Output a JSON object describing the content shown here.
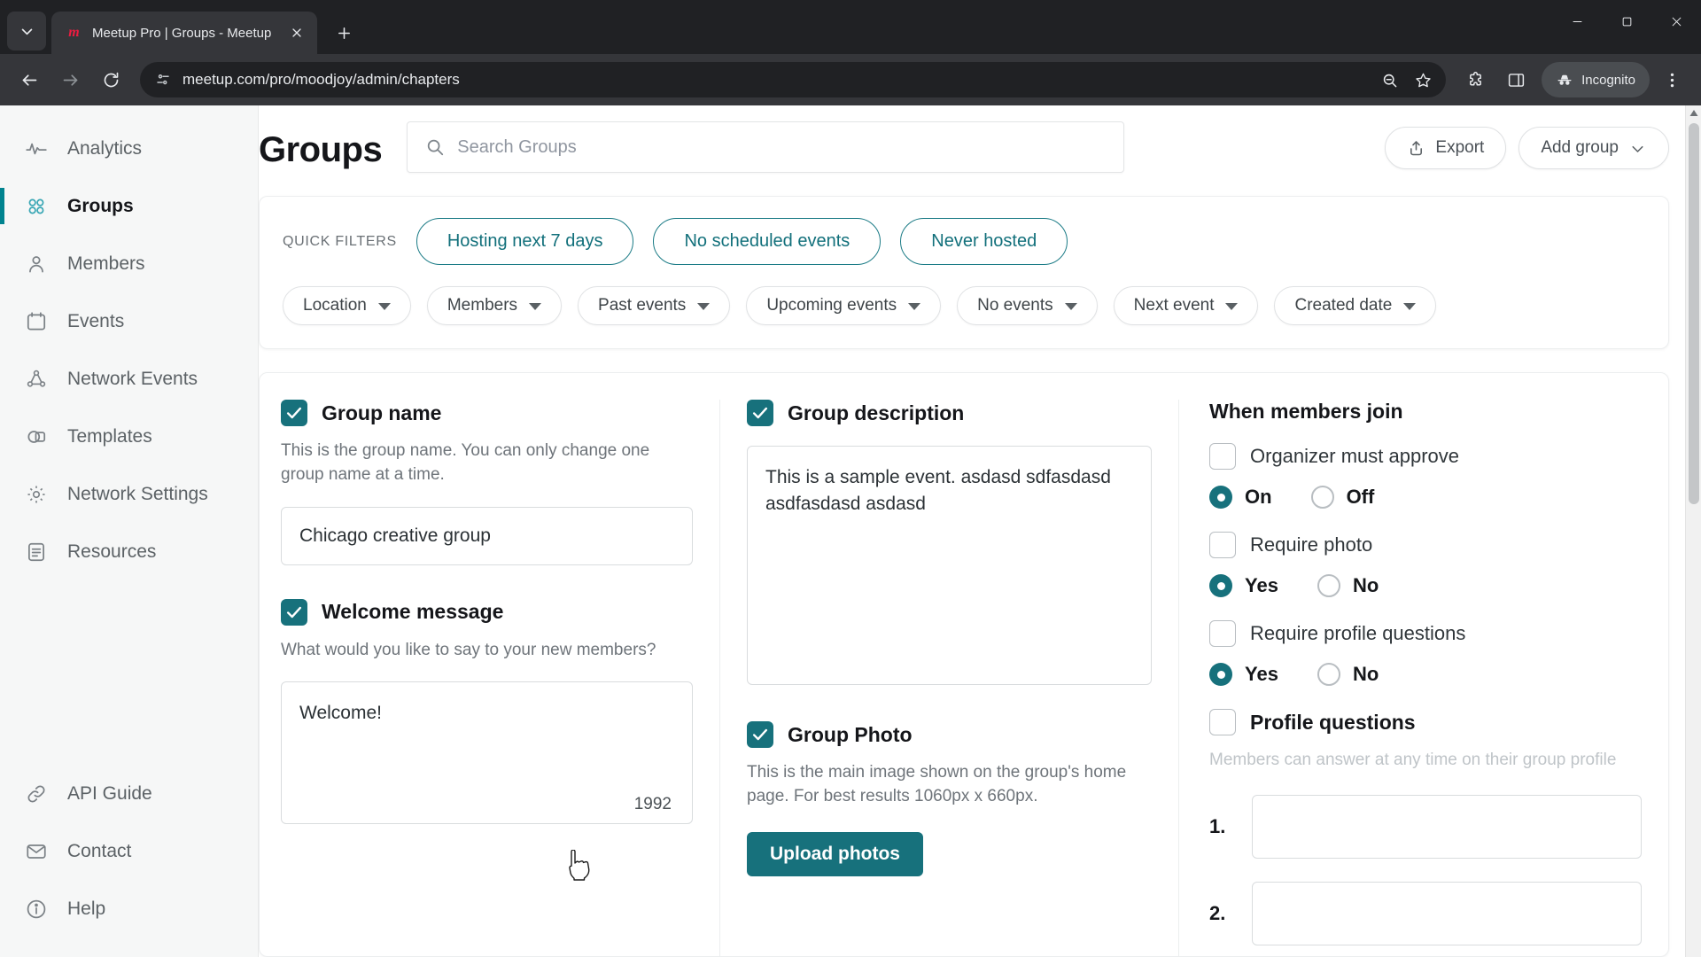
{
  "browser": {
    "tab": {
      "title": "Meetup Pro | Groups - Meetup",
      "favicon_label": "m"
    },
    "url": "meetup.com/pro/moodjoy/admin/chapters",
    "incognito_label": "Incognito"
  },
  "sidebar": {
    "items": [
      {
        "label": "Analytics",
        "icon": "analytics-icon",
        "active": false
      },
      {
        "label": "Groups",
        "icon": "groups-icon",
        "active": true
      },
      {
        "label": "Members",
        "icon": "members-icon",
        "active": false
      },
      {
        "label": "Events",
        "icon": "events-icon",
        "active": false
      },
      {
        "label": "Network Events",
        "icon": "network-events-icon",
        "active": false
      },
      {
        "label": "Templates",
        "icon": "templates-icon",
        "active": false
      },
      {
        "label": "Network Settings",
        "icon": "gear-icon",
        "active": false
      },
      {
        "label": "Resources",
        "icon": "resources-icon",
        "active": false
      }
    ],
    "bottom_items": [
      {
        "label": "API Guide",
        "icon": "link-icon"
      },
      {
        "label": "Contact",
        "icon": "envelope-icon"
      },
      {
        "label": "Help",
        "icon": "info-icon"
      }
    ]
  },
  "header": {
    "title": "Groups",
    "search_placeholder": "Search Groups",
    "search_value": "",
    "export_label": "Export",
    "add_group_label": "Add group"
  },
  "filters": {
    "quick_filters_label": "QUICK FILTERS",
    "quick_filters": [
      "Hosting next 7 days",
      "No scheduled events",
      "Never hosted"
    ],
    "dropdowns": [
      "Location",
      "Members",
      "Past events",
      "Upcoming events",
      "No events",
      "Next event",
      "Created date"
    ]
  },
  "form": {
    "group_name": {
      "title": "Group name",
      "checked": true,
      "description": "This is the group name. You can only change one group name at a time.",
      "value": "Chicago creative group"
    },
    "welcome_message": {
      "title": "Welcome message",
      "checked": true,
      "description": "What would you like to say to your new members?",
      "value": "Welcome!",
      "char_count": "1992"
    },
    "group_description": {
      "title": "Group description",
      "checked": true,
      "value": "This is a sample event. asdasd sdfasdasd asdfasdasd asdasd"
    },
    "group_photo": {
      "title": "Group Photo",
      "checked": true,
      "description": "This is the main image shown on the group's home page. For best results 1060px x 660px.",
      "upload_label": "Upload photos"
    },
    "when_members_join": {
      "title": "When members join",
      "options": [
        {
          "label": "Organizer must approve",
          "checked": false,
          "radios": [
            {
              "label": "On",
              "selected": true
            },
            {
              "label": "Off",
              "selected": false
            }
          ]
        },
        {
          "label": "Require photo",
          "checked": false,
          "radios": [
            {
              "label": "Yes",
              "selected": true
            },
            {
              "label": "No",
              "selected": false
            }
          ]
        },
        {
          "label": "Require profile questions",
          "checked": false,
          "radios": [
            {
              "label": "Yes",
              "selected": true
            },
            {
              "label": "No",
              "selected": false
            }
          ]
        }
      ]
    },
    "profile_questions": {
      "title": "Profile questions",
      "checked": false,
      "description": "Members can answer at any time on their group profile",
      "questions": [
        {
          "num": "1.",
          "value": ""
        },
        {
          "num": "2.",
          "value": ""
        }
      ]
    }
  },
  "colors": {
    "accent_teal": "#17717c",
    "pill_teal": "#12707b",
    "active_bar": "#00838f"
  }
}
